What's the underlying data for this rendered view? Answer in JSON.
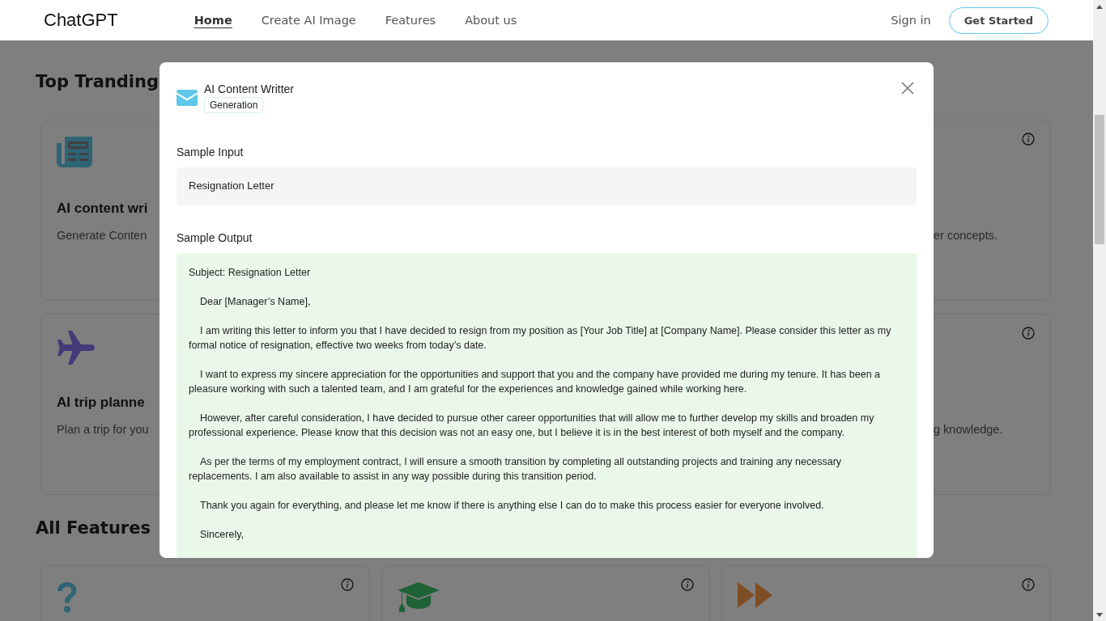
{
  "header": {
    "logo": "ChatGPT",
    "nav": [
      {
        "label": "Home",
        "selected": true
      },
      {
        "label": "Create AI Image",
        "selected": false
      },
      {
        "label": "Features",
        "selected": false
      },
      {
        "label": "About us",
        "selected": false
      }
    ],
    "sign_in": "Sign in",
    "cta": "Get Started"
  },
  "top_trending": {
    "title": "Top Tranding",
    "cards": [
      {
        "kind": "newspaper",
        "title": "AI content wri",
        "description": "Generate Conten",
        "info": false
      },
      {
        "kind": "blank",
        "description": "er concepts.",
        "info": true
      },
      {
        "kind": "plane",
        "title": "AI trip planne",
        "description": "Plan a trip for you",
        "info": false
      },
      {
        "kind": "blank",
        "description": "g knowledge.",
        "info": true
      }
    ]
  },
  "all_features": {
    "title": "All Features",
    "cards": [
      {
        "kind": "question",
        "info": true
      },
      {
        "kind": "cap",
        "info": true
      },
      {
        "kind": "forward",
        "info": true
      }
    ]
  },
  "modal": {
    "title": "AI Content Writter",
    "tag": "Generation",
    "input_label": "Sample Input",
    "input": "Resignation Letter",
    "output_label": "Sample Output",
    "output": [
      "Subject: Resignation Letter",
      "Dear [Manager’s Name],",
      "I am writing this letter to inform you that I have decided to resign from my position as [Your Job Title] at [Company Name]. Please consider this letter as my formal notice of resignation, effective two weeks from today’s date.",
      "I want to express my sincere appreciation for the opportunities and support that you and the company have provided me during my tenure. It has been a pleasure working with such a talented team, and I am grateful for the experiences and knowledge gained while working here.",
      "However, after careful consideration, I have decided to pursue other career opportunities that will allow me to further develop my skills and broaden my professional experience. Please know that this decision was not an easy one, but I believe it is in the best interest of both myself and the company.",
      "As per the terms of my employment contract, I will ensure a smooth transition by completing all outstanding projects and training any necessary replacements. I am also available to assist in any way possible during this transition period.",
      "Thank you again for everything, and please let me know if there is anything else I can do to make this process easier for everyone involved.",
      "Sincerely,"
    ]
  }
}
